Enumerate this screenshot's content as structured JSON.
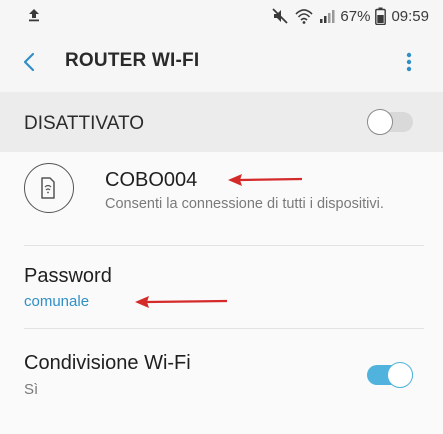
{
  "status_bar": {
    "battery": "67%",
    "time": "09:59",
    "icons": [
      "upload-icon",
      "mute-icon",
      "wifi-hotspot-icon",
      "signal-icon",
      "battery-icon"
    ]
  },
  "app_bar": {
    "title": "ROUTER WI-FI",
    "accent_color": "#2f8fc6"
  },
  "master_switch": {
    "label": "DISATTIVATO",
    "enabled": false
  },
  "network": {
    "name": "COBO004",
    "subtitle": "Consenti la connessione di tutti i dispositivi."
  },
  "password": {
    "title": "Password",
    "value": "comunale",
    "value_color": "#2f8fc6"
  },
  "wifi_sharing": {
    "title": "Condivisione Wi-Fi",
    "value": "Sì",
    "enabled": true,
    "toggle_color": "#4fb3dd"
  },
  "annotations": {
    "arrow_color": "#d42a2a"
  }
}
